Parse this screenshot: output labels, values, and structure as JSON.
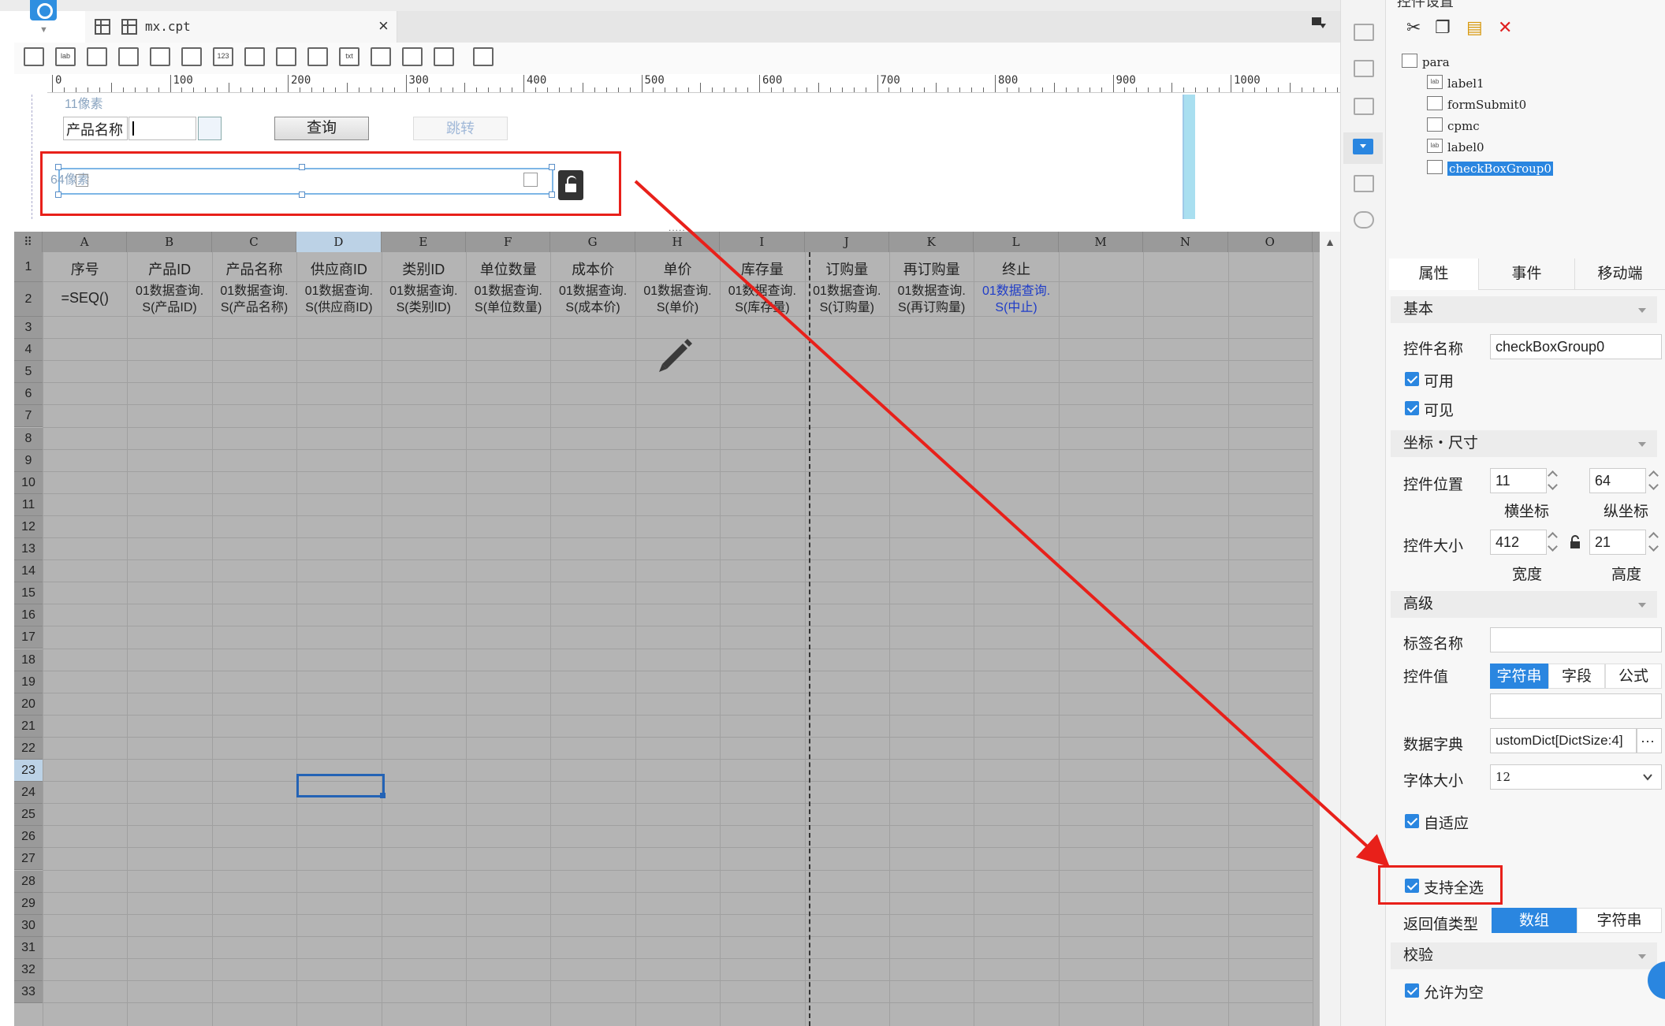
{
  "editor": {
    "file_tab_name": "mx.cpt",
    "file_close": "×",
    "toolbar_labels": [
      "lab",
      "123",
      "txt"
    ],
    "ruler_marks": [
      "0",
      "100",
      "200",
      "300",
      "400",
      "500",
      "600",
      "700",
      "800",
      "900",
      "1000"
    ],
    "param_pane": {
      "px_label_top": "11像素",
      "px_label_widget": "64像素",
      "product_name_label": "产品名称",
      "query_button": "查询",
      "jump_button": "跳转",
      "splitter": "....."
    }
  },
  "sheet": {
    "columns": [
      "A",
      "B",
      "C",
      "D",
      "E",
      "F",
      "G",
      "H",
      "I",
      "J",
      "K",
      "L",
      "M",
      "N",
      "O"
    ],
    "selected_column": "D",
    "headers": [
      "序号",
      "产品ID",
      "产品名称",
      "供应商ID",
      "类别ID",
      "单位数量",
      "成本价",
      "单价",
      "库存量",
      "订购量",
      "再订购量",
      "终止"
    ],
    "formula_cell": "=SEQ()",
    "data_row_line1": [
      "01数据查询.",
      "01数据查询.",
      "01数据查询.",
      "01数据查询.",
      "01数据查询.",
      "01数据查询.",
      "01数据查询.",
      "01数据查询.",
      "01数据查询.",
      "01数据查询.",
      "01数据查询."
    ],
    "data_row_line2": [
      "S(产品ID)",
      "S(产品名称)",
      "S(供应商ID)",
      "S(类别ID)",
      "S(单位数量)",
      "S(成本价)",
      "S(单价)",
      "S(库存量)",
      "S(订购量)",
      "S(再订购量)",
      "S(中止)"
    ],
    "row_numbers": [
      "1",
      "2",
      "3",
      "4",
      "5",
      "6",
      "7",
      "8",
      "9",
      "10",
      "11",
      "12",
      "13",
      "14",
      "15",
      "16",
      "17",
      "18",
      "19",
      "20",
      "21",
      "22",
      "23",
      "24",
      "25",
      "26",
      "27",
      "28",
      "29",
      "30",
      "31",
      "32",
      "33"
    ],
    "selected_row": "23",
    "scroll_up": "▲"
  },
  "panel": {
    "title_partial": "控件设置",
    "tree": [
      {
        "label": "para",
        "icon": "para-icon"
      },
      {
        "label": "label1",
        "icon": "label-icon"
      },
      {
        "label": "formSubmit0",
        "icon": "submit-icon"
      },
      {
        "label": "cpmc",
        "icon": "combobox-icon"
      },
      {
        "label": "label0",
        "icon": "label-icon"
      },
      {
        "label": "checkBoxGroup0",
        "icon": "checkbox-group-icon"
      }
    ],
    "tree_icon_text": "lab",
    "tabs": [
      "属性",
      "事件",
      "移动端"
    ],
    "sections": {
      "basic": "基本",
      "coords": "坐标・尺寸",
      "advanced": "高级",
      "validation": "校验"
    },
    "fields": {
      "widget_name_label": "控件名称",
      "widget_name_value": "checkBoxGroup0",
      "enabled": "可用",
      "visible": "可见",
      "position_label": "控件位置",
      "x": "11",
      "y": "64",
      "x_caption": "横坐标",
      "y_caption": "纵坐标",
      "size_label": "控件大小",
      "width": "412",
      "height": "21",
      "width_caption": "宽度",
      "height_caption": "高度",
      "tag_name_label": "标签名称",
      "tag_name_value": "",
      "value_label": "控件值",
      "value_modes": [
        "字符串",
        "字段",
        "公式"
      ],
      "value_mode_selected": "字符串",
      "dict_label": "数据字典",
      "dict_value": "ustomDict[DictSize:4]",
      "dict_more": "···",
      "font_size_label": "字体大小",
      "font_size_value": "12",
      "adaptive": "自适应",
      "select_all": "支持全选",
      "return_type_label": "返回值类型",
      "return_types": [
        "数组",
        "字符串"
      ],
      "return_type_selected": "数组",
      "allow_empty": "允许为空"
    }
  },
  "colors": {
    "accent": "#2a86e0",
    "annotation_red": "#e8201a",
    "sheet_bg": "#b4b4b4"
  }
}
